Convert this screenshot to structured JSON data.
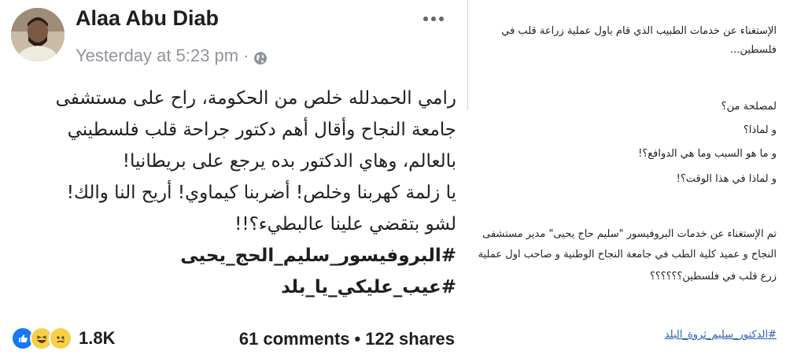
{
  "post": {
    "author": "Alaa Abu Diab",
    "timestamp": "Yesterday at 5:23 pm",
    "privacy_icon": "globe-icon",
    "lines": [
      "رامي الحمدلله خلص من الحكومة، راح على مستشفى",
      "جامعة النجاح وأقال أهم دكتور جراحة قلب فلسطيني",
      "بالعالم، وهاي الدكتور بده يرجع على بريطانيا!",
      "يا زلمة كهربنا وخلص! أضربنا كيماوي! أريح النا والك!",
      "لشو بتقضي علينا عالبطيء؟!!"
    ],
    "hashtags": [
      "#البروفيسور_سليم_الحج_يحيى",
      "#عيب_عليكي_يا_بلد"
    ],
    "reaction_count": "1.8K",
    "comments": "61 comments",
    "shares": "122 shares"
  },
  "note": {
    "intro_line1": "الإستغناء عن خدمات الطبيب الذي قام باول عملية زراعة قلب في",
    "intro_line2": "فلسطين...",
    "q1": "لمصلحة من؟",
    "q2": "و لماذا؟",
    "q3": "و ما هو السبب وما هي الدوافع؟!",
    "q4": "و لماذا في هذا الوقت؟!",
    "body_line1": "تم الإستغناء عن خدمات البروفيسور \"سليم حاج يحيى\" مدير مستشفى",
    "body_line2": "النجاح و عميد كلية الطب في جامعة النجاح الوطنية و صاحب اول عملية",
    "body_line3": "زرع قلب في فلسطين؟؟؟؟؟؟",
    "hashtag": "#الدكتور_سليم_ثروة_البلد"
  }
}
